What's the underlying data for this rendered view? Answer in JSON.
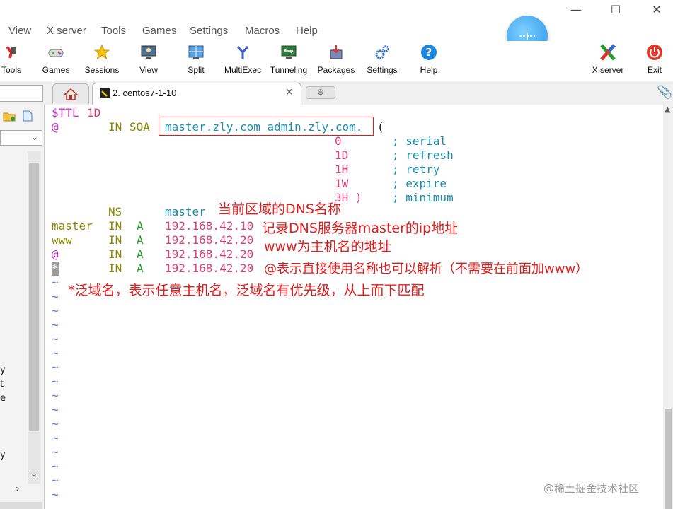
{
  "menubar": {
    "items": [
      "View",
      "X server",
      "Tools",
      "Games",
      "Settings",
      "Macros",
      "Help"
    ]
  },
  "toolbar": {
    "left_buttons": [
      "Tools",
      "Games",
      "Sessions",
      "View",
      "Split",
      "MultiExec",
      "Tunneling",
      "Packages",
      "Settings",
      "Help"
    ],
    "right_buttons": [
      "X server",
      "Exit"
    ]
  },
  "tabs": {
    "active_label": "2. centos7-1-10"
  },
  "terminal": {
    "line1": {
      "k": "$TTL",
      "v": "1D"
    },
    "line2": {
      "at": "@",
      "in": "IN",
      "soa": "SOA",
      "boxed": "master.zly.com admin.zly.com.",
      "paren": "("
    },
    "soa_values": [
      {
        "value": "0",
        "comment": "; serial"
      },
      {
        "value": "1D",
        "comment": "; refresh"
      },
      {
        "value": "1H",
        "comment": "; retry"
      },
      {
        "value": "1W",
        "comment": "; expire"
      },
      {
        "value": "3H )",
        "comment": "; minimum"
      }
    ],
    "ns_line": {
      "type": "NS",
      "value": "master"
    },
    "records": [
      {
        "name": "master",
        "cls": "IN",
        "type": "A",
        "ip": "192.168.42.10"
      },
      {
        "name": "www",
        "cls": "IN",
        "type": "A",
        "ip": "192.168.42.20"
      },
      {
        "name": "@",
        "cls": "IN",
        "type": "A",
        "ip": "192.168.42.20"
      },
      {
        "name": "*",
        "cls": "IN",
        "type": "A",
        "ip": "192.168.42.20"
      }
    ],
    "tilde": "~"
  },
  "annotations": {
    "a1": "当前区域的DNS名称",
    "a2": "记录DNS服务器master的ip地址",
    "a3": "www为主机名的地址",
    "a4": "@表示直接使用名称也可以解析（不需要在前面加www）",
    "a5": "*泛域名，表示任意主机名，泛域名有优先级，从上而下匹配"
  },
  "left_panel": {
    "cut_letters": [
      "y",
      "t",
      "e",
      "y"
    ]
  },
  "watermark": "@稀土掘金技术社区",
  "colors": {
    "annotation": "#e21b1b",
    "tilde": "#4a7ee0",
    "ip": "#e0407a",
    "comment": "#1a8fb0"
  }
}
